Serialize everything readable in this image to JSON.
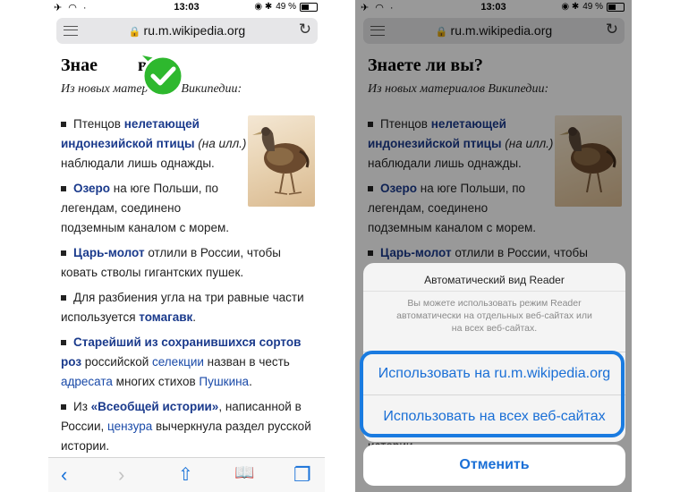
{
  "status_bar": {
    "left_icons": "✈ ◠ ·",
    "time": "13:03",
    "right_icons": "◉ ✱",
    "battery": "49 %"
  },
  "url_bar": {
    "url": "ru.m.wikipedia.org"
  },
  "article": {
    "title": "Знаете ли вы?",
    "title_cropped": "Знае",
    "title_tail": " вы?",
    "subtitle": "Из новых материалов Википедии:",
    "items": [
      {
        "lines": [
          [
            {
              "t": "Птенцов "
            },
            {
              "t": "нелетающей",
              "c": "lnk"
            }
          ],
          [
            {
              "t": "индонезийской птицы",
              "c": "lnk"
            },
            {
              "t": " (на илл.)",
              "c": "ital"
            }
          ],
          [
            {
              "t": "наблюдали лишь однажды."
            }
          ]
        ]
      },
      {
        "lines": [
          [
            {
              "t": "Озеро",
              "c": "lnk"
            },
            {
              "t": " на юге Польши, по"
            }
          ],
          [
            {
              "t": "легендам, соединено"
            }
          ],
          [
            {
              "t": "подземным каналом с морем."
            }
          ]
        ]
      },
      {
        "lines": [
          [
            {
              "t": "Царь-молот",
              "c": "lnk"
            },
            {
              "t": " отлили в России, чтобы"
            }
          ],
          [
            {
              "t": "ковать стволы гигантских пушек."
            }
          ]
        ]
      },
      {
        "lines": [
          [
            {
              "t": "Для разбиения угла на три равные части"
            }
          ],
          [
            {
              "t": "используется "
            },
            {
              "t": "томагавк",
              "c": "lnk"
            },
            {
              "t": "."
            }
          ]
        ]
      },
      {
        "lines": [
          [
            {
              "t": "Старейший из сохранившихся сортов",
              "c": "lnk"
            }
          ],
          [
            {
              "t": "роз",
              "c": "lnk"
            },
            {
              "t": " российской "
            },
            {
              "t": "селекции",
              "c": "lnk2"
            },
            {
              "t": " назван в честь"
            }
          ],
          [
            {
              "t": "адресата",
              "c": "lnk2"
            },
            {
              "t": " многих стихов "
            },
            {
              "t": "Пушкина",
              "c": "lnk2"
            },
            {
              "t": "."
            }
          ]
        ]
      },
      {
        "lines": [
          [
            {
              "t": "Из "
            },
            {
              "t": "«Всеобщей истории»",
              "c": "lnk"
            },
            {
              "t": ", написанной в"
            }
          ],
          [
            {
              "t": "России, "
            },
            {
              "t": "цензура",
              "c": "lnk2"
            },
            {
              "t": " вычеркнула раздел русской"
            }
          ],
          [
            {
              "t": "истории."
            }
          ]
        ]
      }
    ]
  },
  "toolbar": {
    "back": "‹",
    "forward": "›",
    "share": "⇧",
    "bookmarks": "📖",
    "tabs": "❐"
  },
  "dialog": {
    "title": "Автоматический вид Reader",
    "message": "Вы можете использовать режим Reader автоматически на отдельных веб-сайтах или на всех веб-сайтах.",
    "option_site": "Использовать на ru.m.wikipedia.org",
    "option_all": "Использовать на всех веб-сайтах",
    "cancel": "Отменить"
  },
  "colors": {
    "link": "#1a3a8c",
    "accent": "#1a6fd6",
    "highlight": "#1a7be0",
    "check_green": "#2eb82e"
  }
}
